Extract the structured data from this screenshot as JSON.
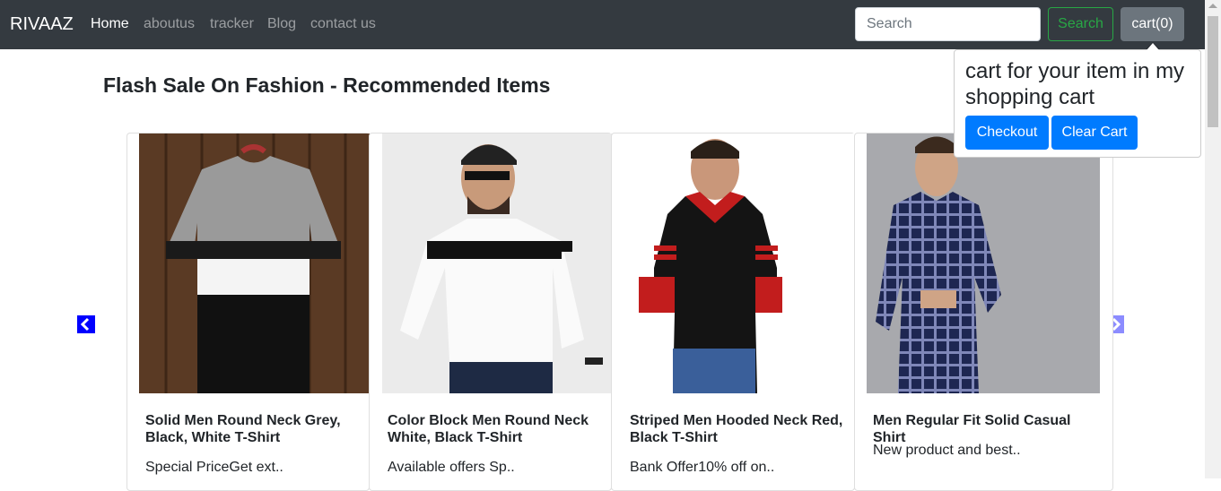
{
  "navbar": {
    "brand": "RIVAAZ",
    "links": [
      {
        "label": "Home"
      },
      {
        "label": "aboutus"
      },
      {
        "label": "tracker"
      },
      {
        "label": "Blog"
      },
      {
        "label": "contact us"
      }
    ],
    "search_placeholder": "Search",
    "search_button": "Search",
    "cart_button": "cart(0)"
  },
  "popover": {
    "title": "cart for your item in my shopping cart",
    "checkout_label": "Checkout",
    "clear_label": "Clear Cart"
  },
  "heading": "Flash Sale On Fashion - Recommended Items",
  "products": [
    {
      "title": "Solid Men Round Neck Grey, Black, White T-Shirt",
      "text": "Special PriceGet ext.."
    },
    {
      "title": "Color Block Men Round Neck White, Black T-Shirt",
      "text": "Available offers Sp.."
    },
    {
      "title": "Striped Men Hooded Neck Red, Black T-Shirt",
      "text": "Bank Offer10% off on.."
    },
    {
      "title": "Men Regular Fit Solid Casual Shirt",
      "text": "New product and best.."
    }
  ],
  "colors": {
    "navbar_bg": "#343a40",
    "primary": "#007bff",
    "success": "#28a745",
    "secondary": "#6c757d",
    "carousel_control": "#0000ff"
  }
}
